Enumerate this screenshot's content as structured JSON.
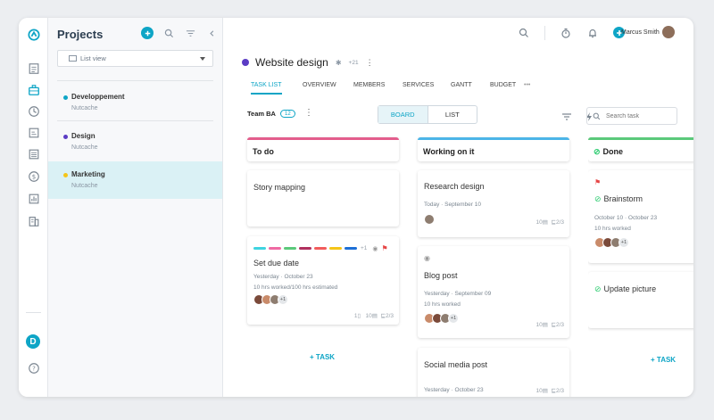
{
  "rail": {
    "icons": [
      "app-logo-icon",
      "document-icon",
      "briefcase-icon",
      "clock-icon",
      "report-icon",
      "list-icon",
      "dollar-icon",
      "chart-icon",
      "building-icon"
    ],
    "user_initial": "D",
    "help_icon": "help-icon"
  },
  "projects": {
    "title": "Projects",
    "view_selector": "List view",
    "items": [
      {
        "name": "Developpement",
        "owner": "Nutcache",
        "color": "#0ea5c6"
      },
      {
        "name": "Design",
        "owner": "Nutcache",
        "color": "#5b3cc4"
      },
      {
        "name": "Marketing",
        "owner": "Nutcache",
        "color": "#f5c518"
      }
    ]
  },
  "topbar": {
    "user_name": "Marcus Smith"
  },
  "project": {
    "title": "Website design",
    "color": "#5b3cc4",
    "member_count": "+21"
  },
  "tabs": [
    "TASK LIST",
    "OVERVIEW",
    "MEMBERS",
    "SERVICES",
    "GANTT",
    "BUDGET",
    "•••"
  ],
  "toolbar": {
    "team": "Team BA",
    "team_count": "12",
    "kebab": "⋮",
    "board_label": "BOARD",
    "list_label": "LIST",
    "search_placeholder": "Search task"
  },
  "columns": [
    {
      "title": "To do",
      "color": "#e35d8c",
      "add_task": "+ TASK",
      "cards": [
        {
          "title": "Story mapping"
        },
        {
          "title": "Set due date",
          "dates": "Yesterday · October 23",
          "worked": "10 hrs worked/100 hrs estimated",
          "label_extra": "+1",
          "avatar_extra": "+1",
          "attachments": "1",
          "comments": "10",
          "subtasks": "2/3"
        }
      ]
    },
    {
      "title": "Working on it",
      "color": "#4cb5e8",
      "cards": [
        {
          "title": "Research design",
          "dates": "Today · September 10",
          "comments": "10",
          "subtasks": "2/3"
        },
        {
          "title": "Blog post",
          "dates": "Yesterday · September 09",
          "worked": "10 hrs worked",
          "avatar_extra": "+1",
          "comments": "10",
          "subtasks": "2/3"
        },
        {
          "title": "Social media post",
          "dates": "Yesterday · October 23",
          "comments": "10",
          "subtasks": "2/3"
        }
      ]
    },
    {
      "title": "Done",
      "color": "#5bc97a",
      "add_task": "+ TASK",
      "cards": [
        {
          "title": "Brainstorm",
          "dates": "October 10 · October 23",
          "worked": "10 hrs worked",
          "avatar_extra": "+1"
        },
        {
          "title": "Update picture"
        }
      ]
    }
  ]
}
